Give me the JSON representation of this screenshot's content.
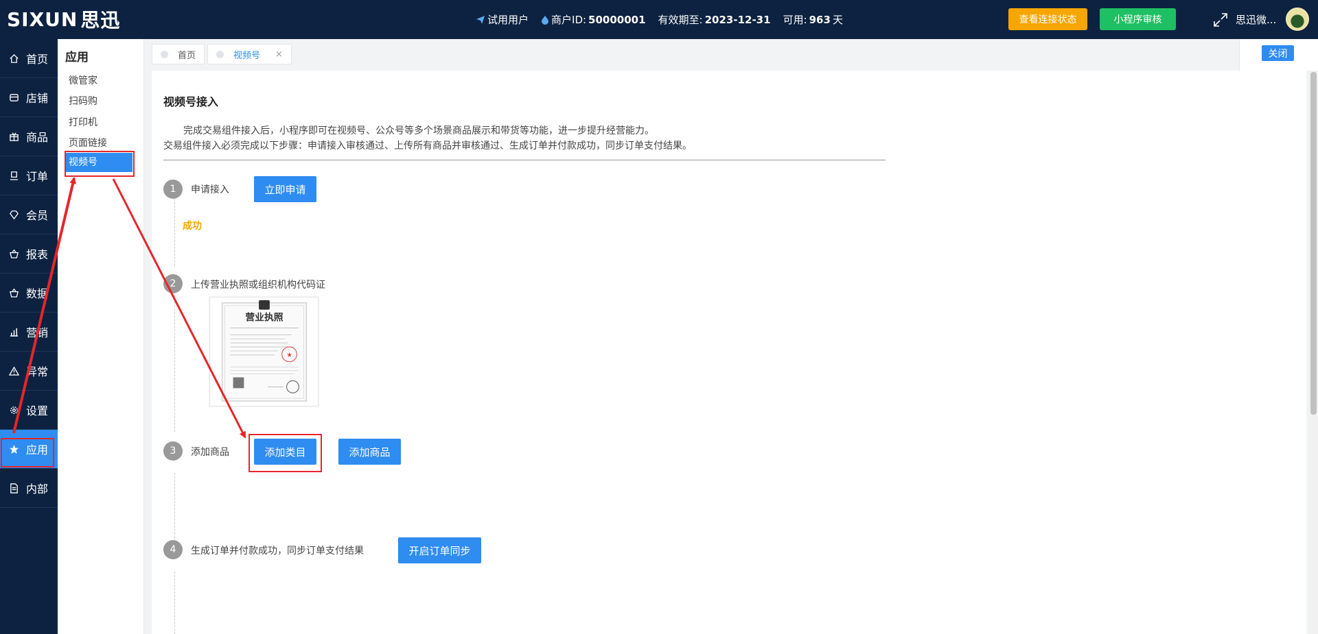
{
  "header": {
    "logo_text": "SIXUN",
    "logo_cn": "思迅",
    "user_type": "试用用户",
    "merchant_label": "商户ID:",
    "merchant_id": "50000001",
    "expiry_label": "有效期至:",
    "expiry_date": "2023-12-31",
    "available_label": "可用:",
    "available_days": "963",
    "available_unit": "天",
    "connection_status_button": "查看连接状态",
    "miniprogram_review_button": "小程序审核",
    "user_name": "思迅微..."
  },
  "sidebar": {
    "items": [
      {
        "label": "首页",
        "icon": "home-icon"
      },
      {
        "label": "店铺",
        "icon": "store-icon"
      },
      {
        "label": "商品",
        "icon": "gift-icon"
      },
      {
        "label": "订单",
        "icon": "order-icon"
      },
      {
        "label": "会员",
        "icon": "diamond-icon"
      },
      {
        "label": "报表",
        "icon": "basket-icon"
      },
      {
        "label": "数据",
        "icon": "basket-icon"
      },
      {
        "label": "营销",
        "icon": "bar-chart-icon"
      },
      {
        "label": "异常",
        "icon": "warning-icon"
      },
      {
        "label": "设置",
        "icon": "gear-icon"
      },
      {
        "label": "应用",
        "icon": "star-icon"
      },
      {
        "label": "内部",
        "icon": "document-icon"
      }
    ],
    "active": "应用"
  },
  "submenu": {
    "title": "应用",
    "items": [
      "微管家",
      "扫码购",
      "打印机",
      "页面链接",
      "视频号"
    ],
    "active": "视频号"
  },
  "tabs": [
    {
      "label": "首页",
      "active": false
    },
    {
      "label": "视频号",
      "active": true,
      "close": "×"
    }
  ],
  "close_button": "关闭",
  "main": {
    "title": "视频号接入",
    "desc1": "完成交易组件接入后，小程序即可在视频号、公众号等多个场景商品展示和带货等功能，进一步提升经营能力。",
    "desc2": "交易组件接入必须完成以下步骤：申请接入审核通过、上传所有商品并审核通过、生成订单并付款成功，同步订单支付结果。",
    "steps": [
      {
        "num": "1",
        "label": "申请接入",
        "button": "立即申请",
        "status": "成功"
      },
      {
        "num": "2",
        "label": "上传营业执照或组织机构代码证"
      },
      {
        "num": "3",
        "label": "添加商品",
        "button": "添加类目",
        "button2": "添加商品"
      },
      {
        "num": "4",
        "label": "生成订单并付款成功，同步订单支付结果",
        "button": "开启订单同步"
      }
    ],
    "license_title": "营业执照"
  },
  "colors": {
    "nav_bg": "#0d2240",
    "accent": "#2f8cf0",
    "orange": "#f7a600",
    "green": "#1fbf63",
    "annotation_red": "#e5262b"
  }
}
